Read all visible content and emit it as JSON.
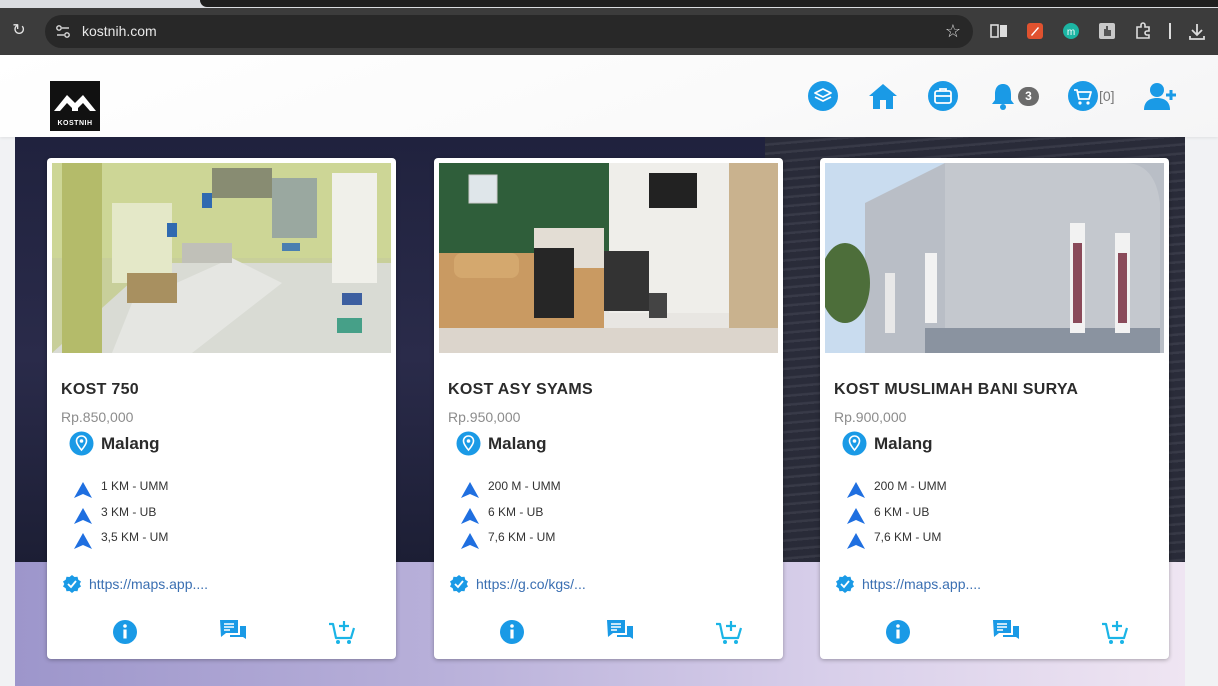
{
  "browser": {
    "url": "kostnih.com"
  },
  "header": {
    "logo_text": "KOSTNIH",
    "notification_count": "3",
    "cart_count": "[0]"
  },
  "cards": [
    {
      "title": "KOST 750",
      "price": "Rp.850,000",
      "city": "Malang",
      "distances": [
        "1 KM - UMM",
        "3 KM - UB",
        "3,5 KM - UM"
      ],
      "link": "https://maps.app...."
    },
    {
      "title": "KOST ASY SYAMS",
      "price": "Rp.950,000",
      "city": "Malang",
      "distances": [
        "200 M - UMM",
        "6 KM - UB",
        "7,6 KM - UM"
      ],
      "link": "https://g.co/kgs/..."
    },
    {
      "title": "KOST MUSLIMAH BANI SURYA",
      "price": "Rp.900,000",
      "city": "Malang",
      "distances": [
        "200 M - UMM",
        "6 KM - UB",
        "7,6 KM - UM"
      ],
      "link": "https://maps.app...."
    }
  ],
  "colors": {
    "accent": "#1a9ae6",
    "cart_accent": "#1ab4e6",
    "link": "#3a6fb2"
  }
}
